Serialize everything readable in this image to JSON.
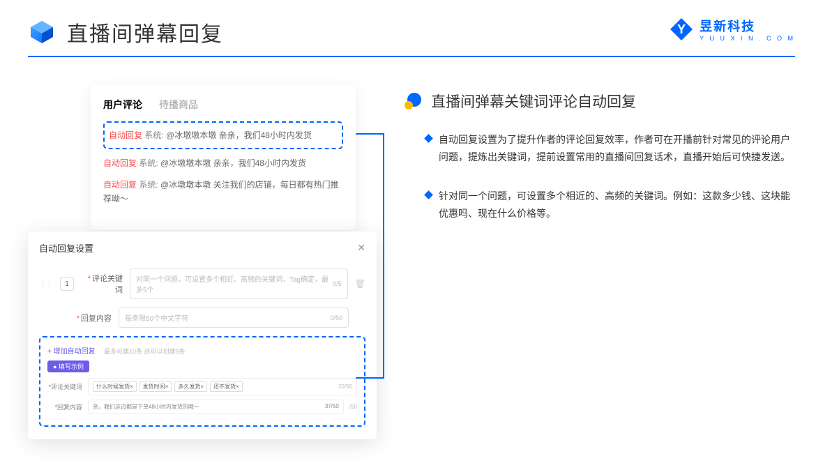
{
  "header": {
    "title": "直播间弹幕回复",
    "brand_name": "昱新科技",
    "brand_url": "Y U U X I N . C O M"
  },
  "card1": {
    "tab_active": "用户评论",
    "tab_inactive": "待播商品",
    "c1_tag": "自动回复",
    "c1_sys": "系统:",
    "c1_text": "@冰墩墩本墩 亲亲，我们48小时内发货",
    "c2_tag": "自动回复",
    "c2_sys": "系统:",
    "c2_text": "@冰墩墩本墩 亲亲，我们48小时内发货",
    "c3_tag": "自动回复",
    "c3_sys": "系统:",
    "c3_text": "@冰墩墩本墩 关注我们的店铺，每日都有热门推荐呦～"
  },
  "modal": {
    "title": "自动回复设置",
    "num": "1",
    "label1": "评论关键词",
    "ph1": "对同一个问题，可设置多个相近、高频的关键词，Tag确定，最多5个",
    "ct1": "0/5",
    "label2": "回复内容",
    "ph2": "每条限50个中文字符",
    "ct2": "0/50",
    "add_link": "+ 增加自动回复",
    "add_note": "最多可建10条 还可以创建9条",
    "eg_badge": "● 填写示例",
    "eg_label1": "评论关键词",
    "eg_t1": "什么时候发货×",
    "eg_t2": "发货时间×",
    "eg_t3": "多久发货×",
    "eg_t4": "还不发货×",
    "eg_ct1": "20/50",
    "eg_label2": "回复内容",
    "eg_text": "亲，我们这边都是下单48小时内发货的哦～",
    "eg_ct2": "37/50",
    "eg_side": "/50"
  },
  "right": {
    "section_title": "直播间弹幕关键词评论自动回复",
    "p1": "自动回复设置为了提升作者的评论回复效率，作者可在开播前针对常见的评论用户问题，提炼出关键词，提前设置常用的直播间回复话术，直播开始后可快捷发送。",
    "p2": "针对同一个问题，可设置多个相近的、高频的关键词。例如：这款多少钱、这块能优惠吗、现在什么价格等。"
  }
}
